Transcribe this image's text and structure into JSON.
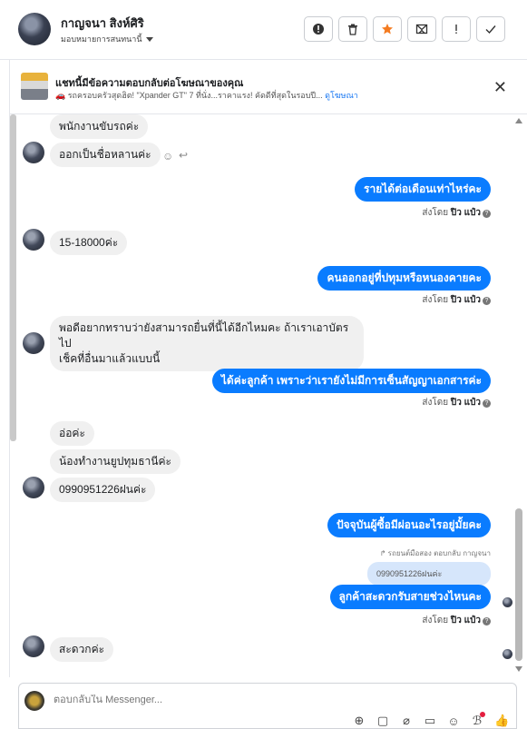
{
  "header": {
    "name": "กาญจนา สิงห์ศิริ",
    "assign_label": "มอบหมายการสนทนานี้",
    "actions": [
      "alert-circle",
      "trash",
      "star",
      "mark-spam",
      "important",
      "done"
    ]
  },
  "ad": {
    "title": "แชทนี้มีข้อความตอบกลับต่อโฆษณาของคุณ",
    "subtitle": "🚗 รถครอบครัวสุดฮิต! \"Xpander GT\" 7 ที่นั่ง...ราคาแรง! คัดดีที่สุดในรอบปี...",
    "link": "ดูโฆษณา"
  },
  "messages": {
    "m1": "พนักงานขับรถค่ะ",
    "m2": "ออกเป็นชื่อหลานค่ะ",
    "m3": "รายได้ต่อเดือนเท่าไหร่คะ",
    "m4": "15-18000ค่ะ",
    "m5": "คนออกอยู่ที่ปทุมหรือหนองคายคะ",
    "m6_line1": "พอดีอยากทราบว่ายังสามารถยื่นที่นี้ได้อีกไหมคะ ถ้าเราเอาบัตรไป",
    "m6_line2": "เช็คที่อื่นมาแล้วแบบนี้",
    "m7": "ได้ค่ะลูกค้า เพราะว่าเรายังไม่มีการเซ็นสัญญาเอกสารค่ะ",
    "m8": "อ่อค่ะ",
    "m9": "น้องทำงานยูปทุมธานีค่ะ",
    "m10": "0990951226ฝนค่ะ",
    "m11": "ปัจจุบันผู้ซื้อมีผ่อนอะไรอยู่มั้ยคะ",
    "reply_hint": "↱ รถยนต์มือสอง ตอบกลับ กาญจนา",
    "quoted": "0990951226ฝนค่ะ",
    "m12": "ลูกค้าสะดวกรับสายช่วงไหนคะ",
    "m13": "สะดวกค่ะ"
  },
  "sent": {
    "prefix": "ส่งโดย",
    "by": "ปิว แป๋ว",
    "help": "?"
  },
  "composer": {
    "placeholder": "ตอบกลับใน Messenger...",
    "tools": [
      "add-contact",
      "shop-bag",
      "attach",
      "saved-reply",
      "emoji",
      "notes",
      "like"
    ]
  }
}
